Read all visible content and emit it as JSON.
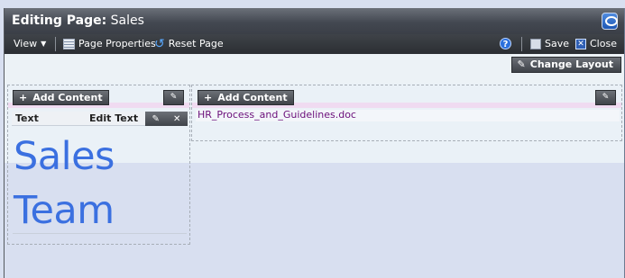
{
  "window": {
    "title_bold": "Editing Page:",
    "title_page": "Sales"
  },
  "toolbar": {
    "view_label": "View",
    "page_properties_label": "Page Properties",
    "reset_page_label": "Reset Page",
    "save_label": "Save",
    "close_label": "Close"
  },
  "layout": {
    "change_layout_label": "Change Layout"
  },
  "left_column": {
    "add_content_label": "Add Content",
    "portlet": {
      "title": "Text",
      "edit_label": "Edit Text",
      "lines": [
        "Sales",
        "Team"
      ]
    }
  },
  "right_column": {
    "add_content_label": "Add Content",
    "document_link": "HR_Process_and_Guidelines.doc"
  },
  "colors": {
    "big_text": "#3b70e0",
    "link": "#6b0f7a",
    "title_bar": "#434851"
  }
}
